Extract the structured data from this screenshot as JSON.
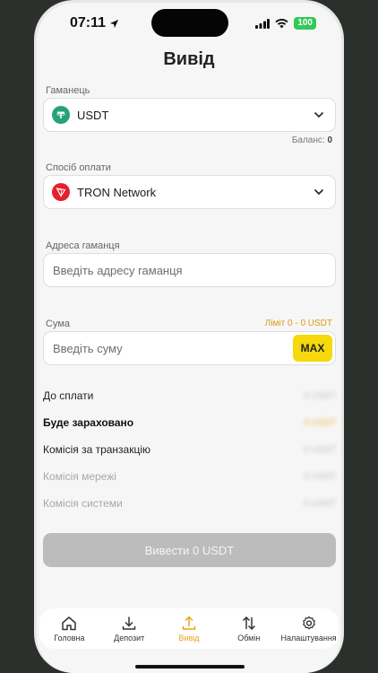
{
  "status_bar": {
    "time": "07:11",
    "battery": "100"
  },
  "page": {
    "title": "Вивід"
  },
  "wallet": {
    "label": "Гаманець",
    "value": "USDT",
    "balance_label": "Баланс:",
    "balance_value": "0"
  },
  "payment": {
    "label": "Спосіб оплати",
    "value": "TRON Network"
  },
  "address": {
    "label": "Адреса гаманця",
    "placeholder": "Введіть адресу гаманця"
  },
  "amount": {
    "label": "Сума",
    "limit": "Ліміт 0 - 0 USDT",
    "placeholder": "Введіть суму",
    "max_label": "MAX"
  },
  "summary": [
    {
      "label": "До сплати",
      "value": "0 USDT"
    },
    {
      "label": "Буде зараховано",
      "value": "0 USDT"
    },
    {
      "label": "Комісія за транзакцію",
      "value": "0 USDT"
    },
    {
      "label": "Комісія мережі",
      "value": "0 USDT"
    },
    {
      "label": "Комісія системи",
      "value": "0 USDT"
    }
  ],
  "submit": {
    "label": "Вивести 0 USDT"
  },
  "tabs": [
    {
      "label": "Головна",
      "icon": "home-icon"
    },
    {
      "label": "Депозит",
      "icon": "download-icon"
    },
    {
      "label": "Вивід",
      "icon": "upload-icon",
      "active": true
    },
    {
      "label": "Обмін",
      "icon": "swap-icon"
    },
    {
      "label": "Налаштування",
      "icon": "gear-icon"
    }
  ],
  "colors": {
    "accent": "#e9a319",
    "max_button": "#f5d90a",
    "usdt": "#26a17b",
    "tron": "#e5202a"
  }
}
